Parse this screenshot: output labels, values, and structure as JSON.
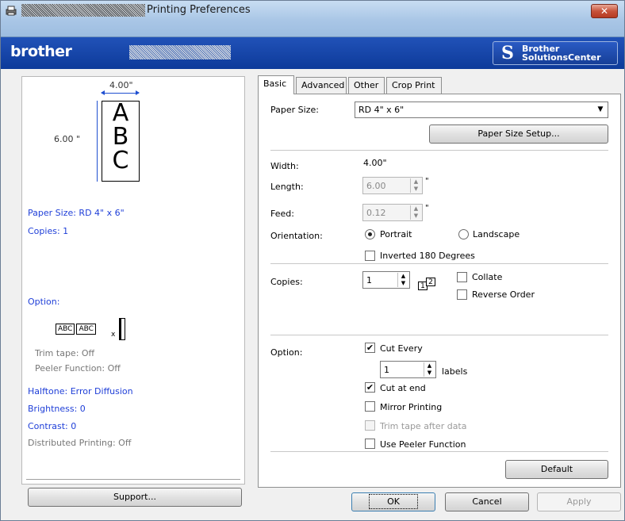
{
  "window": {
    "title": "Printing Preferences",
    "close_glyph": "✕"
  },
  "brand": {
    "logo": "brother",
    "solutions_line1": "Brother",
    "solutions_line2": "SolutionsCenter",
    "solutions_icon": "S"
  },
  "preview": {
    "width_label": "4.00\"",
    "height_label": "6.00 \"",
    "letters": [
      "A",
      "B",
      "C"
    ],
    "paper_size": "Paper Size: RD 4\" x 6\"",
    "copies": "Copies: 1",
    "option_heading": "Option:",
    "abc_1": "ABC",
    "abc_2": "ABC",
    "cut_mark": "x",
    "trim_tape": "Trim tape: Off",
    "peeler": "Peeler Function: Off",
    "halftone": "Halftone: Error Diffusion",
    "brightness": "Brightness:  0",
    "contrast": "Contrast:  0",
    "distributed": "Distributed Printing: Off"
  },
  "buttons": {
    "support": "Support...",
    "ok": "OK",
    "cancel": "Cancel",
    "apply": "Apply",
    "default": "Default",
    "paper_size_setup": "Paper Size Setup..."
  },
  "tabs": [
    "Basic",
    "Advanced",
    "Other",
    "Crop Print"
  ],
  "basic": {
    "paper_size_label": "Paper Size:",
    "paper_size_value": "RD 4\" x 6\"",
    "width_label": "Width:",
    "width_value": "4.00\"",
    "length_label": "Length:",
    "length_value": "6.00",
    "feed_label": "Feed:",
    "feed_value": "0.12",
    "unit": "\"",
    "orientation_label": "Orientation:",
    "portrait": "Portrait",
    "landscape": "Landscape",
    "orientation_selected": "Portrait",
    "inverted": "Inverted 180 Degrees",
    "copies_label": "Copies:",
    "copies_value": "1",
    "collate": "Collate",
    "reverse_order": "Reverse Order",
    "collate_icon_1": "1",
    "collate_icon_2": "2",
    "option_label": "Option:",
    "cut_every": "Cut Every",
    "cut_every_value": "1",
    "labels_suffix": "labels",
    "cut_at_end": "Cut at end",
    "mirror_printing": "Mirror Printing",
    "trim_tape_after_data": "Trim tape after data",
    "use_peeler": "Use Peeler Function",
    "check_mark": "✔",
    "spin_up": "▲",
    "spin_down": "▼",
    "dropdown_arrow": "▼"
  }
}
